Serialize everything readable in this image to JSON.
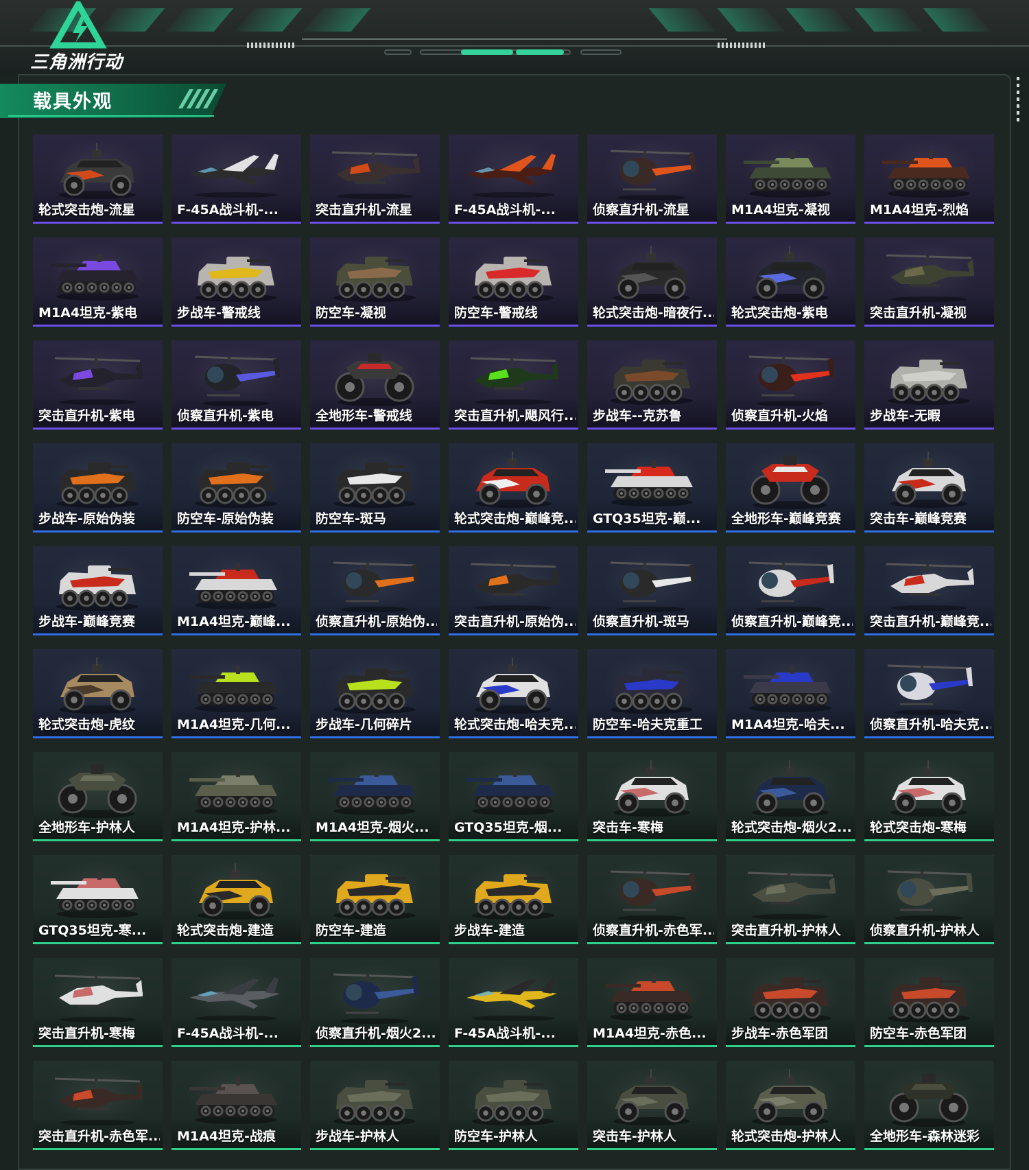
{
  "app": {
    "logo_text": "三角洲行动"
  },
  "section": {
    "title": "载具外观"
  },
  "colors": {
    "accent_green": "#35d29b",
    "rarity_purple": "#6a4ee6",
    "rarity_blue": "#2f6ee6",
    "rarity_green": "#2fcf8c"
  },
  "skins": [
    {
      "label": "轮式突击炮-流星",
      "rarity": "purple",
      "vehicle": "armored-car",
      "body": "#3a3a3a",
      "accent": "#d24a1a"
    },
    {
      "label": "F-45A战斗机-...",
      "rarity": "purple",
      "vehicle": "jet",
      "body": "#2c2c2c",
      "accent": "#e2e2e2"
    },
    {
      "label": "突击直升机-流星",
      "rarity": "purple",
      "vehicle": "attack-heli",
      "body": "#3a3030",
      "accent": "#d24a1a"
    },
    {
      "label": "F-45A战斗机-...",
      "rarity": "purple",
      "vehicle": "jet",
      "body": "#4a1e14",
      "accent": "#e0551c"
    },
    {
      "label": "侦察直升机-流星",
      "rarity": "purple",
      "vehicle": "scout-heli",
      "body": "#3a2a26",
      "accent": "#e0551c"
    },
    {
      "label": "M1A4坦克-凝视",
      "rarity": "purple",
      "vehicle": "tank",
      "body": "#3c4a36",
      "accent": "#7a8a5a"
    },
    {
      "label": "M1A4坦克-烈焰",
      "rarity": "purple",
      "vehicle": "tank",
      "body": "#4a2a1e",
      "accent": "#e0551c"
    },
    {
      "label": "M1A4坦克-紫电",
      "rarity": "purple",
      "vehicle": "tank",
      "body": "#26222e",
      "accent": "#7a4ae0"
    },
    {
      "label": "步战车-警戒线",
      "rarity": "purple",
      "vehicle": "ifv",
      "body": "#b8b4b0",
      "accent": "#e0b81c"
    },
    {
      "label": "防空车-凝视",
      "rarity": "purple",
      "vehicle": "ifv",
      "body": "#4a4e3a",
      "accent": "#8a6a4a"
    },
    {
      "label": "防空车-警戒线",
      "rarity": "purple",
      "vehicle": "ifv",
      "body": "#b8b4b0",
      "accent": "#d82a2a"
    },
    {
      "label": "轮式突击炮-暗夜行...",
      "rarity": "purple",
      "vehicle": "armored-car",
      "body": "#2a2a2a",
      "accent": "#555555"
    },
    {
      "label": "轮式突击炮-紫电",
      "rarity": "purple",
      "vehicle": "armored-car",
      "body": "#24262e",
      "accent": "#5a6ae0"
    },
    {
      "label": "突击直升机-凝视",
      "rarity": "purple",
      "vehicle": "attack-heli",
      "body": "#3e4232",
      "accent": "#6a6a4a"
    },
    {
      "label": "突击直升机-紫电",
      "rarity": "purple",
      "vehicle": "attack-heli",
      "body": "#24222c",
      "accent": "#7a4ae0"
    },
    {
      "label": "侦察直升机-紫电",
      "rarity": "purple",
      "vehicle": "scout-heli",
      "body": "#22242a",
      "accent": "#5a5ae0"
    },
    {
      "label": "全地形车-警戒线",
      "rarity": "purple",
      "vehicle": "atv",
      "body": "#3a3a3a",
      "accent": "#c82a2a"
    },
    {
      "label": "突击直升机-飓风行...",
      "rarity": "purple",
      "vehicle": "attack-heli",
      "body": "#1e3a1a",
      "accent": "#5ae01c"
    },
    {
      "label": "步战车--克苏鲁",
      "rarity": "purple",
      "vehicle": "ifv",
      "body": "#3a3a32",
      "accent": "#7a4a2a"
    },
    {
      "label": "侦察直升机-火焰",
      "rarity": "purple",
      "vehicle": "scout-heli",
      "body": "#3a1e1a",
      "accent": "#e0321c"
    },
    {
      "label": "步战车-无暇",
      "rarity": "purple",
      "vehicle": "ifv",
      "body": "#b0b0aa",
      "accent": "#d0d0ca"
    },
    {
      "label": "步战车-原始伪装",
      "rarity": "blue",
      "vehicle": "ifv",
      "body": "#2a2a2a",
      "accent": "#e0701c"
    },
    {
      "label": "防空车-原始伪装",
      "rarity": "blue",
      "vehicle": "ifv",
      "body": "#2a2a2a",
      "accent": "#e0701c"
    },
    {
      "label": "防空车-斑马",
      "rarity": "blue",
      "vehicle": "ifv",
      "body": "#2a2a2a",
      "accent": "#e8e8e8"
    },
    {
      "label": "轮式突击炮-巅峰竞...",
      "rarity": "blue",
      "vehicle": "armored-car",
      "body": "#c82a1c",
      "accent": "#f0f0f0"
    },
    {
      "label": "GTQ35坦克-巅...",
      "rarity": "blue",
      "vehicle": "tank",
      "body": "#d8d8d8",
      "accent": "#d82a1c"
    },
    {
      "label": "全地形车-巅峰竞赛",
      "rarity": "blue",
      "vehicle": "atv",
      "body": "#c82a1c",
      "accent": "#e8e8e8"
    },
    {
      "label": "突击车-巅峰竞赛",
      "rarity": "blue",
      "vehicle": "armored-car",
      "body": "#d8d8d8",
      "accent": "#c82a1c"
    },
    {
      "label": "步战车-巅峰竞赛",
      "rarity": "blue",
      "vehicle": "ifv",
      "body": "#d8d8d8",
      "accent": "#c82a1c"
    },
    {
      "label": "M1A4坦克-巅峰...",
      "rarity": "blue",
      "vehicle": "tank",
      "body": "#d8d8d8",
      "accent": "#c82a1c"
    },
    {
      "label": "侦察直升机-原始伪...",
      "rarity": "blue",
      "vehicle": "scout-heli",
      "body": "#2a2a2a",
      "accent": "#e0701c"
    },
    {
      "label": "突击直升机-原始伪...",
      "rarity": "blue",
      "vehicle": "attack-heli",
      "body": "#2a2a2a",
      "accent": "#e0701c"
    },
    {
      "label": "侦察直升机-斑马",
      "rarity": "blue",
      "vehicle": "scout-heli",
      "body": "#2a2a2a",
      "accent": "#e8e8e8"
    },
    {
      "label": "侦察直升机-巅峰竞...",
      "rarity": "blue",
      "vehicle": "scout-heli",
      "body": "#d8d8d8",
      "accent": "#c82a1c"
    },
    {
      "label": "突击直升机-巅峰竞...",
      "rarity": "blue",
      "vehicle": "attack-heli",
      "body": "#d8d8d8",
      "accent": "#c82a1c"
    },
    {
      "label": "轮式突击炮-虎纹",
      "rarity": "blue",
      "vehicle": "armored-car",
      "body": "#a88a60",
      "accent": "#4a3a2a"
    },
    {
      "label": "M1A4坦克-几何...",
      "rarity": "blue",
      "vehicle": "tank",
      "body": "#2a2a2a",
      "accent": "#b8e01c"
    },
    {
      "label": "步战车-几何碎片",
      "rarity": "blue",
      "vehicle": "ifv",
      "body": "#2a2a2a",
      "accent": "#b8e01c"
    },
    {
      "label": "轮式突击炮-哈夫克...",
      "rarity": "blue",
      "vehicle": "armored-car",
      "body": "#e0e0e0",
      "accent": "#2a3ac8"
    },
    {
      "label": "防空车-哈夫克重工",
      "rarity": "blue",
      "vehicle": "ifv",
      "body": "#2a2a3a",
      "accent": "#2a3ac8"
    },
    {
      "label": "M1A4坦克-哈夫...",
      "rarity": "blue",
      "vehicle": "tank",
      "body": "#3a3a4a",
      "accent": "#2a3ac8"
    },
    {
      "label": "侦察直升机-哈夫克...",
      "rarity": "blue",
      "vehicle": "scout-heli",
      "body": "#d8d8e0",
      "accent": "#2a3ac8"
    },
    {
      "label": "全地形车-护林人",
      "rarity": "green",
      "vehicle": "atv",
      "body": "#4a4e40",
      "accent": "#6a6e5a"
    },
    {
      "label": "M1A4坦克-护林...",
      "rarity": "green",
      "vehicle": "tank",
      "body": "#5a5e4a",
      "accent": "#7a7e6a"
    },
    {
      "label": "M1A4坦克-烟火...",
      "rarity": "green",
      "vehicle": "tank",
      "body": "#1e2a4a",
      "accent": "#3a5a9a"
    },
    {
      "label": "GTQ35坦克-烟...",
      "rarity": "green",
      "vehicle": "tank",
      "body": "#1e2a4a",
      "accent": "#3a5a9a"
    },
    {
      "label": "突击车-寒梅",
      "rarity": "green",
      "vehicle": "armored-car",
      "body": "#e0e0e0",
      "accent": "#c86a6a"
    },
    {
      "label": "轮式突击炮-烟火2...",
      "rarity": "green",
      "vehicle": "armored-car",
      "body": "#1e2a4a",
      "accent": "#3a5a9a"
    },
    {
      "label": "轮式突击炮-寒梅",
      "rarity": "green",
      "vehicle": "armored-car",
      "body": "#e0e0e0",
      "accent": "#c86a6a"
    },
    {
      "label": "GTQ35坦克-寒...",
      "rarity": "green",
      "vehicle": "tank",
      "body": "#e0e0e0",
      "accent": "#c86a6a"
    },
    {
      "label": "轮式突击炮-建造",
      "rarity": "green",
      "vehicle": "armored-car",
      "body": "#e0a81c",
      "accent": "#2a2a2a"
    },
    {
      "label": "防空车-建造",
      "rarity": "green",
      "vehicle": "ifv",
      "body": "#e0a81c",
      "accent": "#2a2a2a"
    },
    {
      "label": "步战车-建造",
      "rarity": "green",
      "vehicle": "ifv",
      "body": "#e0a81c",
      "accent": "#2a2a2a"
    },
    {
      "label": "侦察直升机-赤色军...",
      "rarity": "green",
      "vehicle": "scout-heli",
      "body": "#3a2a26",
      "accent": "#c84a2a"
    },
    {
      "label": "突击直升机-护林人",
      "rarity": "green",
      "vehicle": "attack-heli",
      "body": "#4a4e40",
      "accent": "#6a6e5a"
    },
    {
      "label": "侦察直升机-护林人",
      "rarity": "green",
      "vehicle": "scout-heli",
      "body": "#4a4e40",
      "accent": "#6a6e5a"
    },
    {
      "label": "突击直升机-寒梅",
      "rarity": "green",
      "vehicle": "attack-heli",
      "body": "#e0e0e0",
      "accent": "#c86a6a"
    },
    {
      "label": "F-45A战斗机-...",
      "rarity": "green",
      "vehicle": "jet",
      "body": "#5a5e62",
      "accent": "#3a3e42"
    },
    {
      "label": "侦察直升机-烟火2...",
      "rarity": "green",
      "vehicle": "scout-heli",
      "body": "#1e2a4a",
      "accent": "#3a5a9a"
    },
    {
      "label": "F-45A战斗机-...",
      "rarity": "green",
      "vehicle": "jet",
      "body": "#e0b81c",
      "accent": "#2a2a2a"
    },
    {
      "label": "M1A4坦克-赤色...",
      "rarity": "green",
      "vehicle": "tank",
      "body": "#3a2a26",
      "accent": "#c84a2a"
    },
    {
      "label": "步战车-赤色军团",
      "rarity": "green",
      "vehicle": "ifv",
      "body": "#3a2a26",
      "accent": "#c84a2a"
    },
    {
      "label": "防空车-赤色军团",
      "rarity": "green",
      "vehicle": "ifv",
      "body": "#3a2a26",
      "accent": "#c84a2a"
    },
    {
      "label": "突击直升机-赤色军...",
      "rarity": "green",
      "vehicle": "attack-heli",
      "body": "#3a2a26",
      "accent": "#c84a2a"
    },
    {
      "label": "M1A4坦克-战痕",
      "rarity": "green",
      "vehicle": "tank",
      "body": "#3a3634",
      "accent": "#5a5250"
    },
    {
      "label": "步战车-护林人",
      "rarity": "green",
      "vehicle": "ifv",
      "body": "#4a4e40",
      "accent": "#6a6e5a"
    },
    {
      "label": "防空车-护林人",
      "rarity": "green",
      "vehicle": "ifv",
      "body": "#4a4e40",
      "accent": "#6a6e5a"
    },
    {
      "label": "突击车-护林人",
      "rarity": "green",
      "vehicle": "armored-car",
      "body": "#4a4e40",
      "accent": "#6a6e5a"
    },
    {
      "label": "轮式突击炮-护林人",
      "rarity": "green",
      "vehicle": "armored-car",
      "body": "#5a5e4a",
      "accent": "#7a7e6a"
    },
    {
      "label": "全地形车-森林迷彩",
      "rarity": "green",
      "vehicle": "atv",
      "body": "#2e3228",
      "accent": "#4a4e3a"
    }
  ]
}
